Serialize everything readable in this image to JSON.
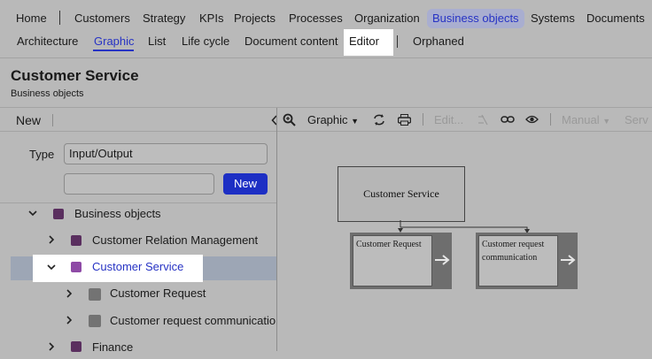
{
  "top_nav": {
    "items": [
      "Home",
      "Customers",
      "Strategy",
      "KPIs",
      "Projects",
      "Processes",
      "Organization",
      "Business objects",
      "Systems",
      "Documents"
    ],
    "active": "Business objects"
  },
  "sub_nav": {
    "items": [
      "Architecture",
      "Graphic",
      "List",
      "Life cycle",
      "Document content",
      "Editor",
      "Orphaned"
    ],
    "selected": "Graphic",
    "highlighted": "Editor"
  },
  "page": {
    "title": "Customer Service",
    "subtitle": "Business objects"
  },
  "left": {
    "new_label": "New",
    "type_label": "Type",
    "type_value": "Input/Output",
    "name_value": "",
    "new_button": "New",
    "tree": [
      {
        "label": "Business objects",
        "color": "#5a2f5f"
      },
      {
        "label": "Customer Relation Management",
        "color": "#5a2f5f"
      },
      {
        "label": "Customer Service",
        "color": "#8e4aa6"
      },
      {
        "label": "Customer Request",
        "color": "#737373"
      },
      {
        "label": "Customer request communication",
        "color": "#737373"
      },
      {
        "label": "Finance",
        "color": "#5a2f5f"
      }
    ]
  },
  "toolbar": {
    "graphic_label": "Graphic",
    "edit_label": "Edit...",
    "manual_label": "Manual",
    "serv_label": "Serv"
  },
  "diagram": {
    "main": "Customer Service",
    "child1": "Customer Request",
    "child2_line1": "Customer request",
    "child2_line2": "communication"
  },
  "colors": {
    "accent": "#2733c4",
    "primary_button": "#1d2fc4",
    "overlay_bg": "#b9b9b9"
  }
}
